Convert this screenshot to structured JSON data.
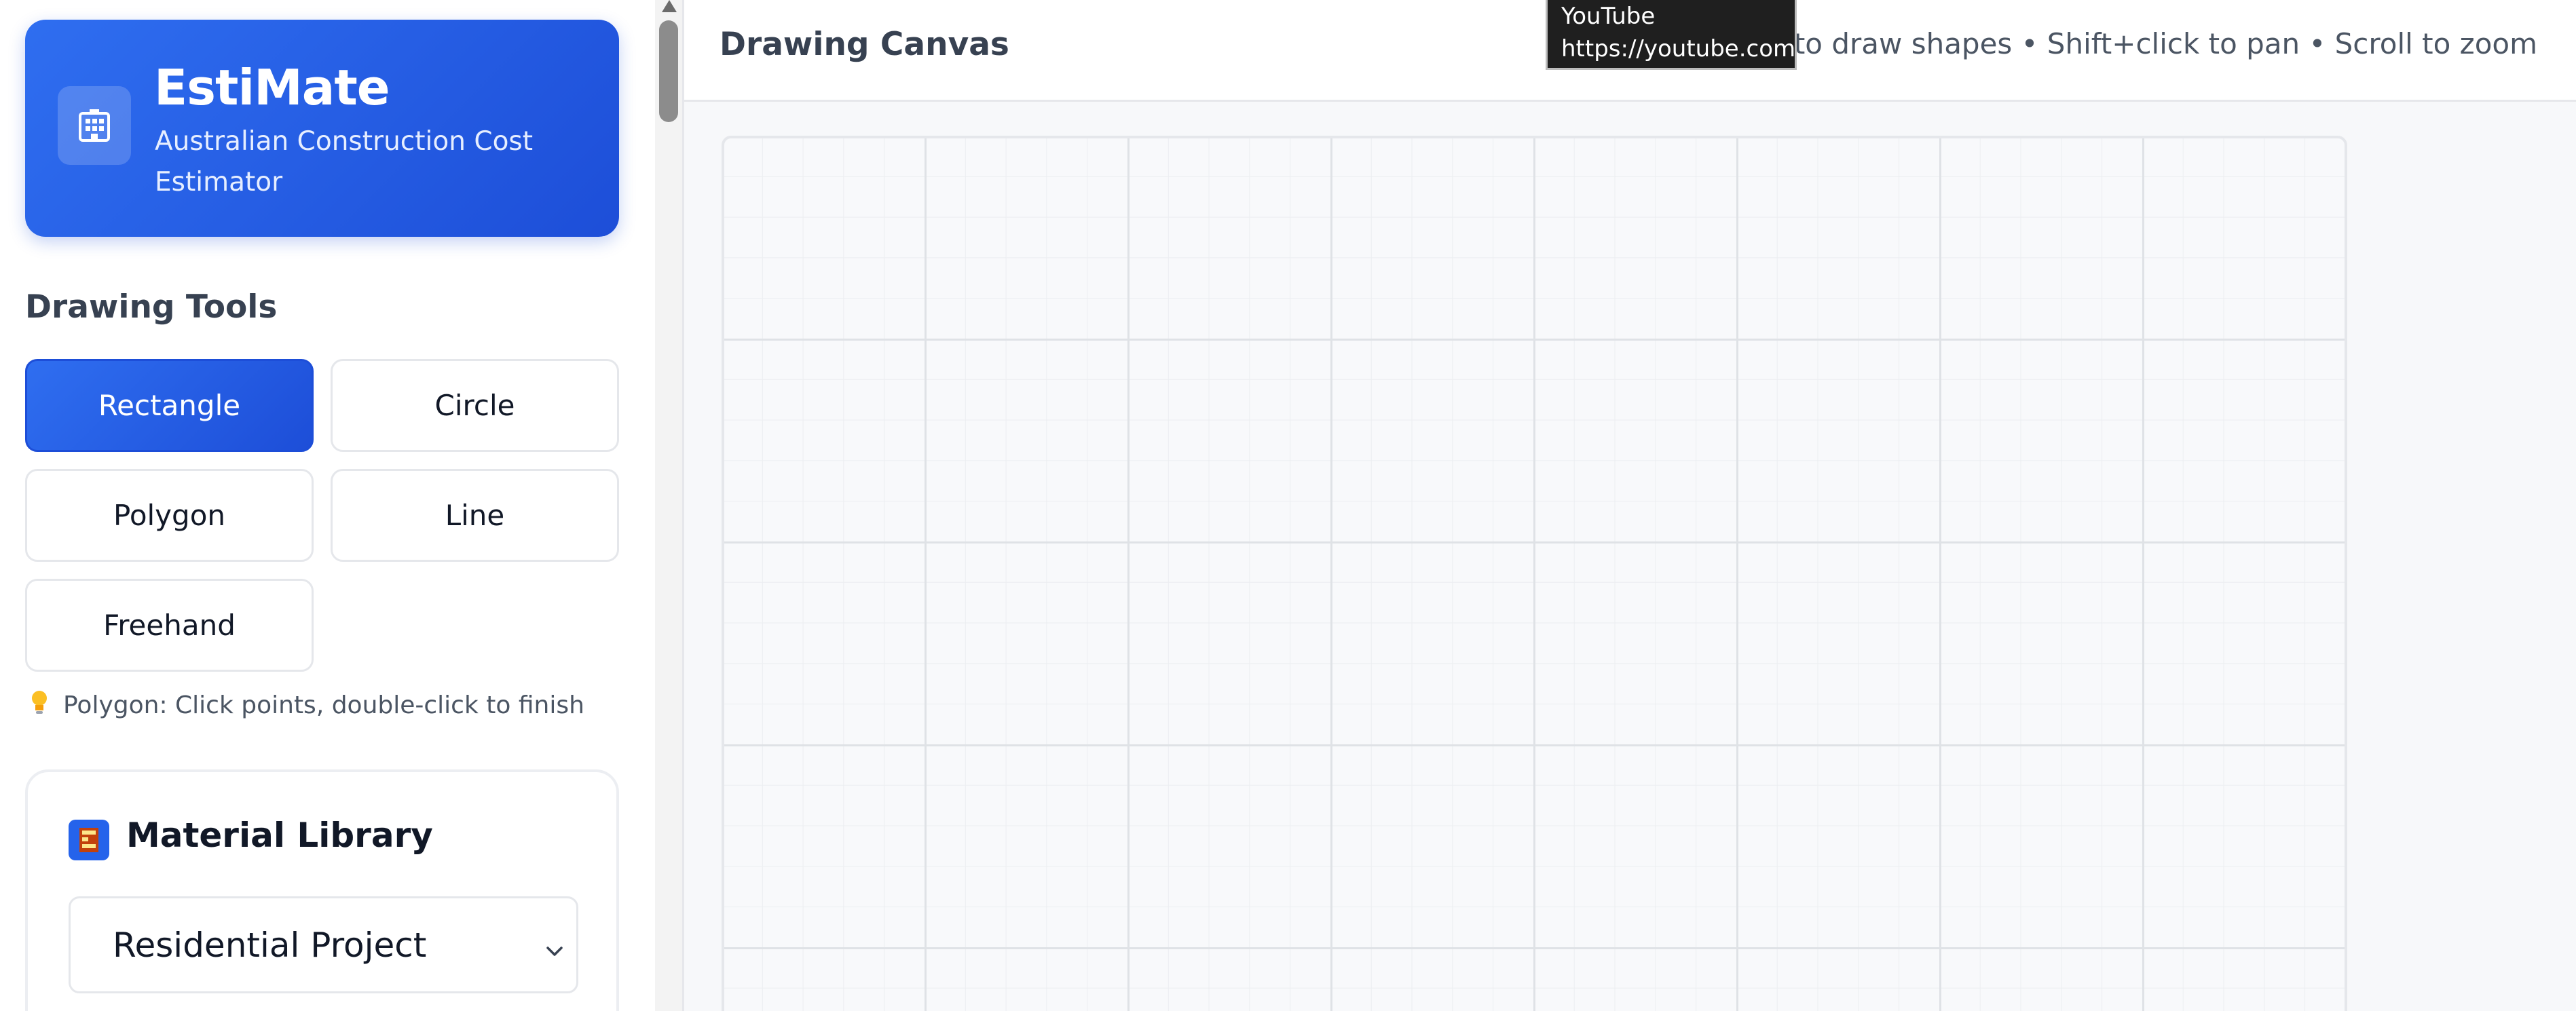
{
  "brand": {
    "title": "EstiMate",
    "subtitle": "Australian Construction Cost Estimator",
    "icon": "building-icon"
  },
  "tools_section": {
    "title": "Drawing Tools",
    "tools": [
      {
        "label": "Rectangle",
        "active": true
      },
      {
        "label": "Circle",
        "active": false
      },
      {
        "label": "Polygon",
        "active": false
      },
      {
        "label": "Line",
        "active": false
      },
      {
        "label": "Freehand",
        "active": false
      }
    ],
    "hint": "Polygon: Click points, double-click to finish",
    "hint_icon": "lightbulb-icon"
  },
  "material_library": {
    "title": "Material Library",
    "icon": "bricks-icon",
    "selected_project": "Residential Project"
  },
  "canvas_header": {
    "title": "Drawing Canvas",
    "instructions": "Click and drag to draw shapes • Shift+click to pan • Scroll to zoom"
  },
  "tooltip": {
    "line1": "YouTube",
    "line2": "https://youtube.com"
  },
  "colors": {
    "accent": "#1d4ed8",
    "accent_light": "#2f6ef0",
    "canvas_bg": "#f8f9fb",
    "grid": "#dfe2e6"
  }
}
